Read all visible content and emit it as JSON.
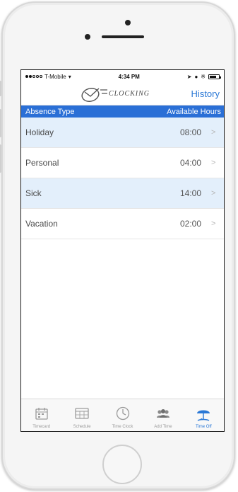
{
  "status": {
    "carrier": "T-Mobile",
    "time": "4:34 PM"
  },
  "brand": {
    "logo_text": "CLOCKING"
  },
  "nav": {
    "history_label": "History"
  },
  "header": {
    "left": "Absence Type",
    "right": "Available Hours"
  },
  "rows": [
    {
      "name": "Holiday",
      "hours": "08:00",
      "chevron": ">"
    },
    {
      "name": "Personal",
      "hours": "04:00",
      "chevron": ">"
    },
    {
      "name": "Sick",
      "hours": "14:00",
      "chevron": ">"
    },
    {
      "name": "Vacation",
      "hours": "02:00",
      "chevron": ">"
    }
  ],
  "tabs": [
    {
      "label": "Timecard",
      "icon": "calendar-icon",
      "active": false
    },
    {
      "label": "Schedule",
      "icon": "schedule-icon",
      "active": false
    },
    {
      "label": "Time Clock",
      "icon": "clock-icon",
      "active": false
    },
    {
      "label": "Add Time",
      "icon": "people-icon",
      "active": false
    },
    {
      "label": "Time Off",
      "icon": "umbrella-icon",
      "active": true
    }
  ],
  "colors": {
    "accent": "#2a78d6",
    "header_bg": "#2a6fd6",
    "row_alt": "#e3effb"
  }
}
